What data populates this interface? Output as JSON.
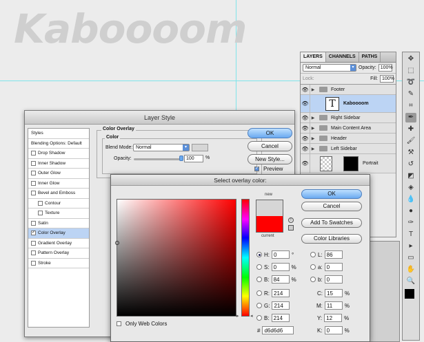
{
  "canvas": {
    "logo_text": "Kaboooom"
  },
  "layers_panel": {
    "tabs": [
      "LAYERS",
      "CHANNELS",
      "PATHS"
    ],
    "blend_mode": "Normal",
    "opacity_label": "Opacity:",
    "opacity": "100%",
    "lock_label": "Lock:",
    "fill_label": "Fill:",
    "fill": "100%",
    "layers": [
      {
        "name": "Footer",
        "type": "folder"
      },
      {
        "name": "Kaboooom",
        "type": "text",
        "thumb": "T"
      },
      {
        "name": "Right Sidebar",
        "type": "folder"
      },
      {
        "name": "Main Content Area",
        "type": "folder"
      },
      {
        "name": "Header",
        "type": "folder"
      },
      {
        "name": "Left Sidebar",
        "type": "folder"
      },
      {
        "name": "Portrait",
        "type": "image"
      }
    ]
  },
  "layer_style": {
    "title": "Layer Style",
    "list": [
      "Styles",
      "Blending Options: Default",
      "Drop Shadow",
      "Inner Shadow",
      "Outer Glow",
      "Inner Glow",
      "Bevel and Emboss",
      "Contour",
      "Texture",
      "Satin",
      "Color Overlay",
      "Gradient Overlay",
      "Pattern Overlay",
      "Stroke"
    ],
    "section_title": "Color Overlay",
    "group_title": "Color",
    "blend_mode_label": "Blend Mode:",
    "blend_mode": "Normal",
    "opacity_label": "Opacity:",
    "opacity": "100",
    "opacity_unit": "%",
    "ok": "OK",
    "cancel": "Cancel",
    "new_style": "New Style...",
    "preview": "Preview"
  },
  "color_picker": {
    "title": "Select overlay color:",
    "new_label": "new",
    "current_label": "current",
    "ok": "OK",
    "cancel": "Cancel",
    "add_swatches": "Add To Swatches",
    "color_libraries": "Color Libraries",
    "only_web_colors": "Only Web Colors",
    "H": {
      "label": "H:",
      "value": "0",
      "unit": "°"
    },
    "S": {
      "label": "S:",
      "value": "0",
      "unit": "%"
    },
    "B": {
      "label": "B:",
      "value": "84",
      "unit": "%"
    },
    "R": {
      "label": "R:",
      "value": "214"
    },
    "G": {
      "label": "G:",
      "value": "214"
    },
    "Bl": {
      "label": "B:",
      "value": "214"
    },
    "L": {
      "label": "L:",
      "value": "86"
    },
    "a": {
      "label": "a:",
      "value": "0"
    },
    "b": {
      "label": "b:",
      "value": "0"
    },
    "C": {
      "label": "C:",
      "value": "15",
      "unit": "%"
    },
    "M": {
      "label": "M:",
      "value": "11",
      "unit": "%"
    },
    "Y": {
      "label": "Y:",
      "value": "12",
      "unit": "%"
    },
    "K": {
      "label": "K:",
      "value": "0",
      "unit": "%"
    },
    "hex_label": "#",
    "hex": "d6d6d6",
    "new_color": "#d6d6d6",
    "current_color": "#ff0000"
  }
}
